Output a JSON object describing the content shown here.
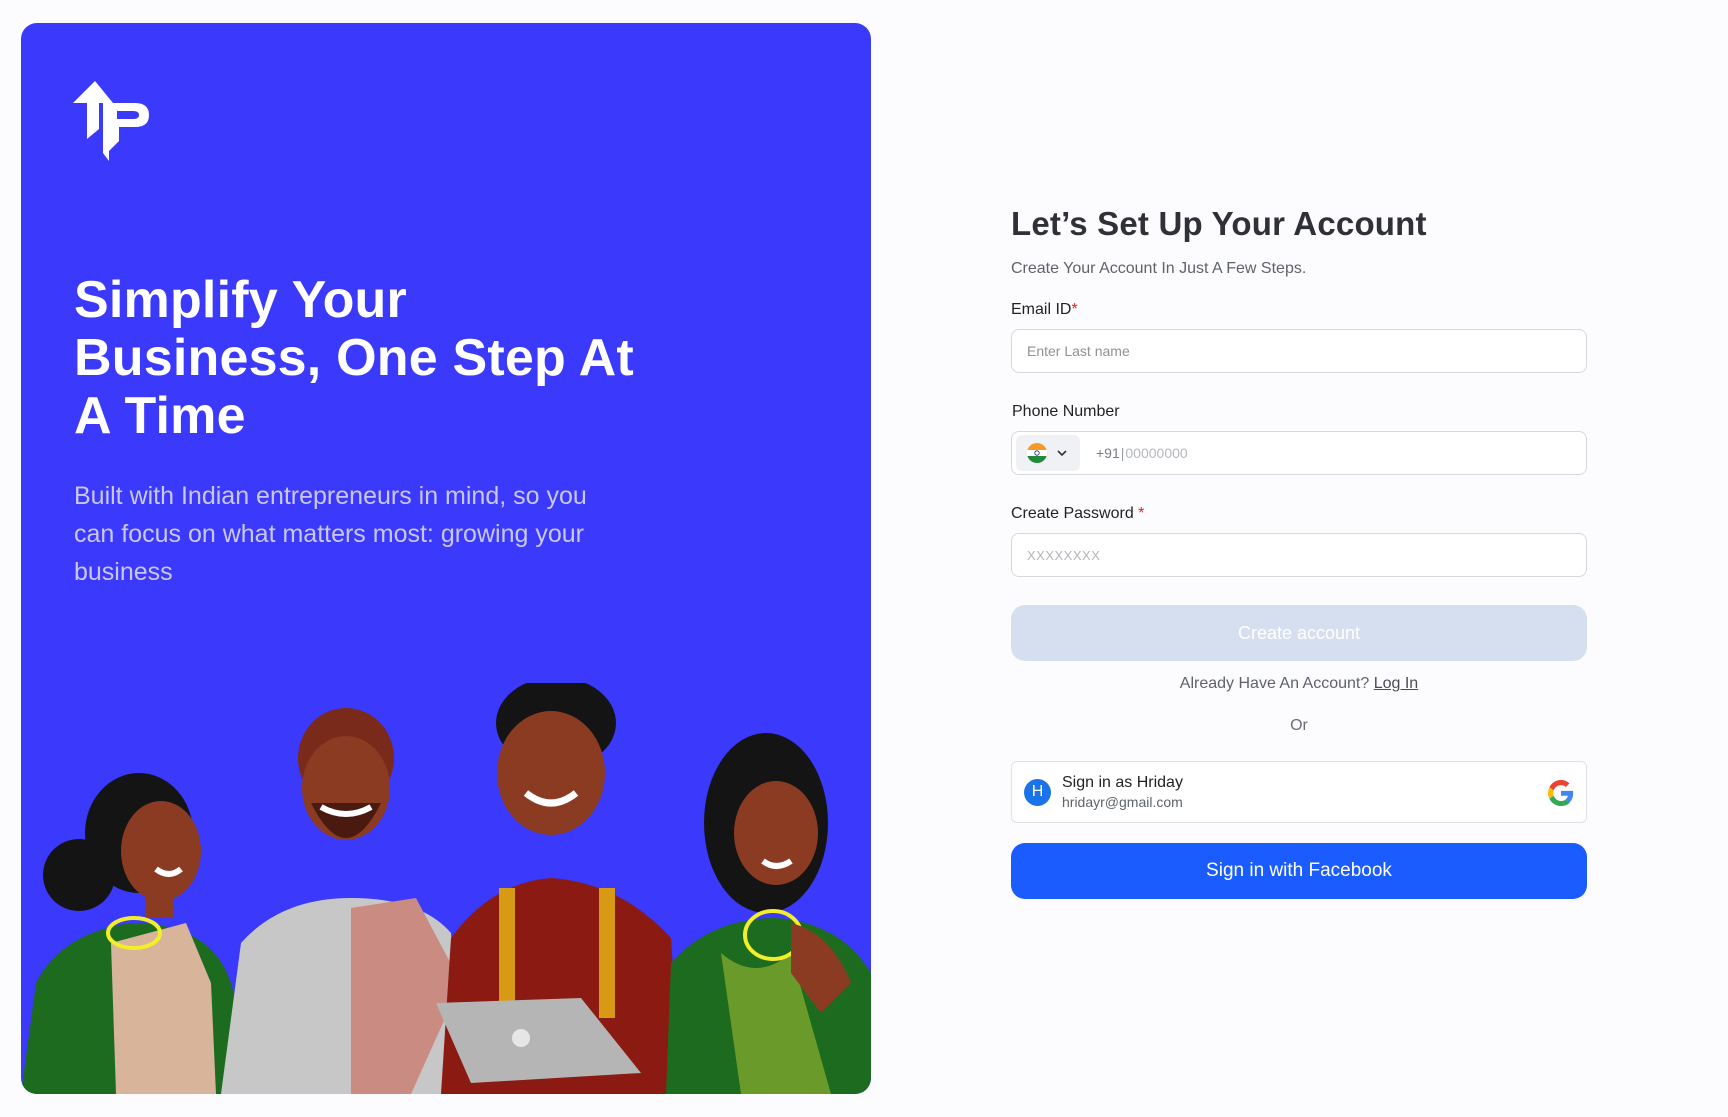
{
  "hero": {
    "logo_icon": "tally-logo-icon",
    "title": "Simplify Your Business, One Step At A Time",
    "subtitle": "Built with Indian entrepreneurs in mind, so you can focus on what matters most: growing your business",
    "background_color": "#3b39fb"
  },
  "form": {
    "title": "Let’s Set Up Your Account",
    "subtitle": "Create Your Account In Just A Few Steps.",
    "email": {
      "label": "Email ID",
      "required_mark": "*",
      "placeholder": "Enter Last name"
    },
    "phone": {
      "label": "Phone Number",
      "country_icon": "india-flag-icon",
      "country_code": "+91",
      "separator": "|",
      "placeholder": "00000000"
    },
    "password": {
      "label": "Create Password",
      "required_mark": "*",
      "placeholder": "XXXXXXXX"
    },
    "create_button": "Create account",
    "already_text": "Already Have An Account?",
    "login_link": "Log In",
    "or_text": "Or",
    "google": {
      "avatar_letter": "H",
      "name": "Sign in as Hriday",
      "email": "hridayr@gmail.com",
      "icon": "google-icon"
    },
    "facebook_button": "Sign in with Facebook",
    "colors": {
      "facebook": "#1a5cff",
      "create_disabled": "#d6dff0",
      "required": "#e02424"
    }
  }
}
